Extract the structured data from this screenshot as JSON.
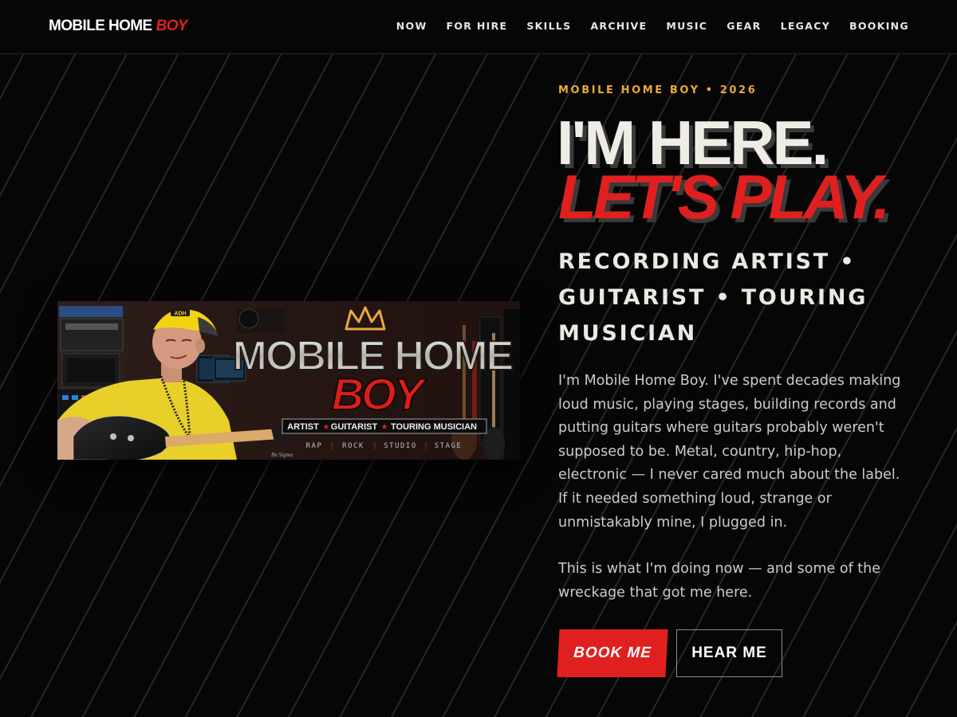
{
  "header": {
    "logo_main": "MOBILE HOME",
    "logo_accent": "BOY",
    "nav": [
      {
        "label": "NOW"
      },
      {
        "label": "FOR HIRE"
      },
      {
        "label": "SKILLS"
      },
      {
        "label": "ARCHIVE"
      },
      {
        "label": "MUSIC"
      },
      {
        "label": "GEAR"
      },
      {
        "label": "LEGACY"
      },
      {
        "label": "BOOKING"
      }
    ]
  },
  "hero": {
    "eyebrow": "MOBILE HOME BOY • 2026",
    "headline_line1": "I'M HERE.",
    "headline_line2": "LET'S PLAY.",
    "roles": "RECORDING ARTIST • GUITARIST • TOURING MUSICIAN",
    "bio_p1": "I'm Mobile Home Boy. I've spent decades making loud music, playing stages, building records and putting guitars where guitars probably weren't supposed to be. Metal, country, hip-hop, electronic — I never cared much about the label. If it needed something loud, strange or unmistakably mine, I plugged in.",
    "bio_p2": "This is what I'm doing now — and some of the wreckage that got me here.",
    "primary_button": "BOOK ME",
    "secondary_button": "HEAR ME"
  },
  "banner": {
    "title_line1": "MOBILE HOME",
    "title_line2": "BOY",
    "tagline": [
      "ARTIST",
      "GUITARIST",
      "TOURING MUSICIAN"
    ],
    "genres": [
      "RAP",
      "ROCK",
      "STUDIO",
      "STAGE"
    ],
    "cap_text": "ADH"
  },
  "colors": {
    "accent_red": "#e0201f",
    "accent_gold": "#e8a93d",
    "background": "#060606",
    "text_light": "#efece6"
  }
}
